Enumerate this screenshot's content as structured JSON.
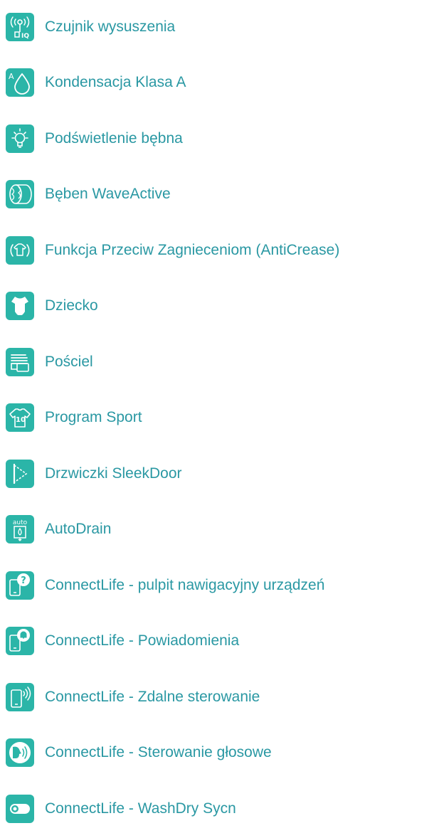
{
  "accent_color": "#2bb5a8",
  "text_color": "#2a98a3",
  "features": [
    {
      "label": "Czujnik wysuszenia",
      "icon": "humidity-sensor-iq-icon"
    },
    {
      "label": "Kondensacja Klasa A",
      "icon": "condensation-class-a-icon"
    },
    {
      "label": "Podświetlenie bębna",
      "icon": "drum-light-bulb-icon"
    },
    {
      "label": "Bęben WaveActive",
      "icon": "waveactive-drum-icon"
    },
    {
      "label": "Funkcja Przeciw Zagnieceniom (AntiCrease)",
      "icon": "anticrease-shirt-icon"
    },
    {
      "label": "Dziecko",
      "icon": "baby-bodysuit-icon"
    },
    {
      "label": "Pościel",
      "icon": "bedding-stack-icon"
    },
    {
      "label": "Program Sport",
      "icon": "sport-jersey-10-icon"
    },
    {
      "label": "Drzwiczki SleekDoor",
      "icon": "sleekdoor-icon"
    },
    {
      "label": "AutoDrain",
      "icon": "autodrain-icon",
      "icon_text": "auto"
    },
    {
      "label": "ConnectLife - pulpit nawigacyjny urządzeń",
      "icon": "phone-question-icon"
    },
    {
      "label": "ConnectLife - Powiadomienia",
      "icon": "phone-notification-bell-icon"
    },
    {
      "label": "ConnectLife - Zdalne sterowanie",
      "icon": "phone-remote-control-icon"
    },
    {
      "label": "ConnectLife - Sterowanie głosowe",
      "icon": "voice-control-icon"
    },
    {
      "label": "ConnectLife - WashDry Sycn",
      "icon": "washdry-sync-toggle-icon"
    }
  ]
}
